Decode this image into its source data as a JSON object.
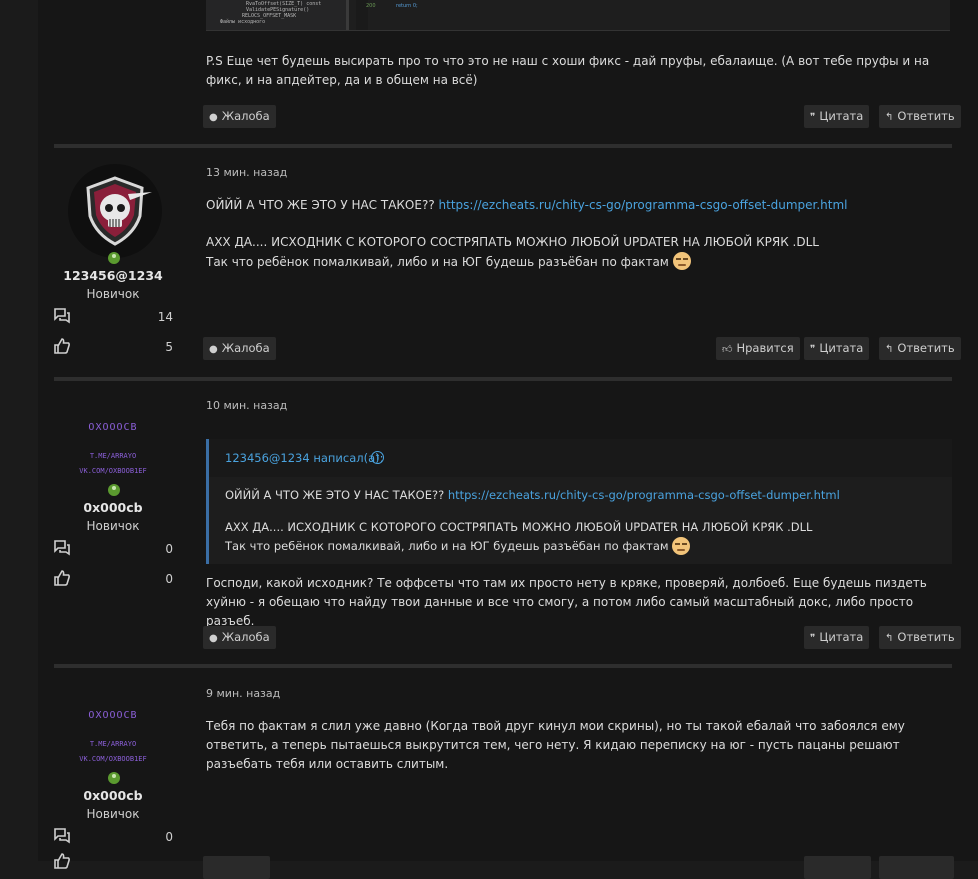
{
  "top_post": {
    "code_lines": [
      "RvaToOffset(SIZE_T) const",
      "ValidatePESignature()",
      "RELOCS_OFFSET_MASK",
      "Файлы исходного"
    ],
    "text": "P.S Еще чет будешь высирать про то что это не наш с хоши фикс - дай пруфы, ебалаище. (А вот тебе пруфы и на фикс, и на апдейтер, да и в общем на всё)",
    "report": "Жалоба",
    "quote": "Цитата",
    "reply": "Ответить"
  },
  "post1": {
    "username": "123456@1234",
    "role": "Новичок",
    "messages": "14",
    "likes": "5",
    "time": "13 мин. назад",
    "line1_prefix": "ОЙЙЙ А ЧТО ЖЕ ЭТО У НАС ТАКОЕ?? ",
    "line1_link": "https://ezcheats.ru/chity-cs-go/programma-csgo-offset-dumper.html",
    "line2": "АХХ ДА.... ИСХОДНИК С КОТОРОГО СОСТРЯПАТЬ МОЖНО ЛЮБОЙ UPDATER НА ЛЮБОЙ КРЯК .DLL",
    "line3": "Так что ребёнок помалкивай, либо и на ЮГ будешь разъёбан по фактам",
    "report": "Жалоба",
    "like": "Нравится",
    "quote": "Цитата",
    "reply": "Ответить"
  },
  "post2": {
    "brand_title": "OXOOOCB",
    "brand_line1": "T.ME/ARRAYO",
    "brand_line2": "VK.COM/OXBOOB1EF",
    "username": "0x000cb",
    "role": "Новичок",
    "messages": "0",
    "likes": "0",
    "time": "10 мин. назад",
    "quote_author": "123456@1234 написал(а):",
    "quote_line1_prefix": "ОЙЙЙ А ЧТО ЖЕ ЭТО У НАС ТАКОЕ?? ",
    "quote_line1_link": "https://ezcheats.ru/chity-cs-go/programma-csgo-offset-dumper.html",
    "quote_line2": "АХХ ДА.... ИСХОДНИК С КОТОРОГО СОСТРЯПАТЬ МОЖНО ЛЮБОЙ UPDATER НА ЛЮБОЙ КРЯК .DLL",
    "quote_line3": "Так что ребёнок помалкивай, либо и на ЮГ будешь разъёбан по фактам",
    "text": "Господи, какой исходник? Те оффсеты что там их просто нету в кряке, проверяй, долбоеб. Еще будешь пиздеть хуйню - я обещаю что найду твои данные и все что смогу, а потом либо самый масштабный докс, либо просто разъеб.",
    "report": "Жалоба",
    "quote": "Цитата",
    "reply": "Ответить"
  },
  "post3": {
    "brand_title": "OXOOOCB",
    "brand_line1": "T.ME/ARRAYO",
    "brand_line2": "VK.COM/OXBOOB1EF",
    "username": "0x000cb",
    "role": "Новичок",
    "messages": "0",
    "time": "9 мин. назад",
    "text": "Тебя по фактам я слил уже давно (Когда твой друг кинул мои скрины), но ты такой ебалай что забоялся ему ответить, а теперь пытаешься выкрутится тем, чего нету. Я кидаю переписку на юг - пусть пацаны решают разъебать тебя или оставить слитым."
  },
  "colors": {
    "link": "#4aa3df",
    "online": "#5b9a2f",
    "brand": "#8b5fd8",
    "quote_bar": "#3a6ea5"
  },
  "icons": [
    "exclamation-circle-icon",
    "thumbs-up-icon",
    "quote-marks-icon",
    "reply-arrow-icon",
    "messages-icon",
    "likes-icon",
    "online-status-icon",
    "smirk-emoji-icon",
    "arrow-up-circle-icon"
  ]
}
